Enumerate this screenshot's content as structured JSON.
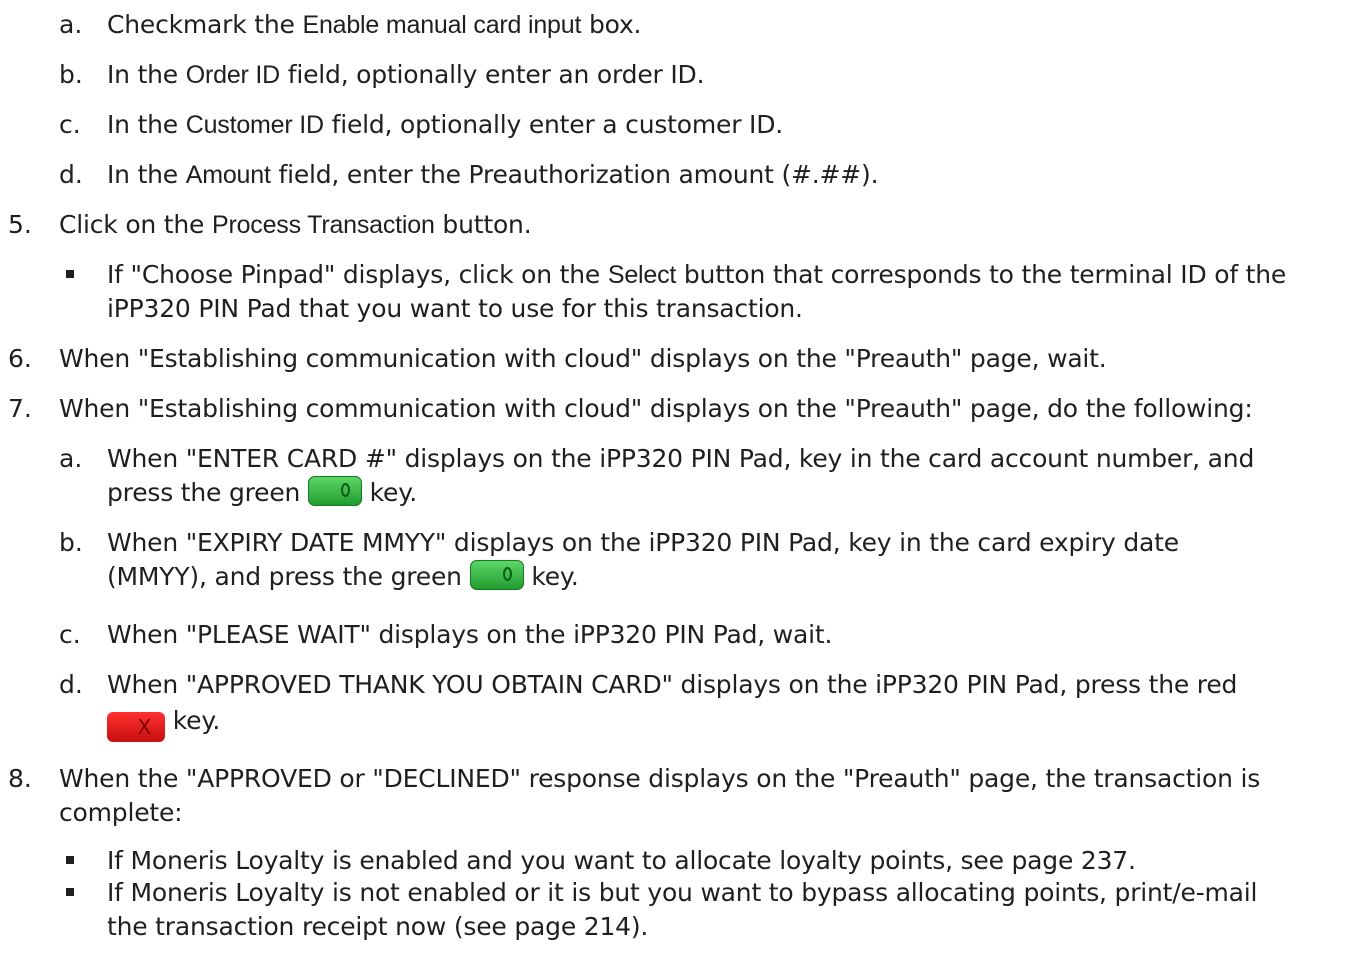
{
  "steps": {
    "s4a": {
      "marker": "a.",
      "pre": "Checkmark the ",
      "ui": "Enable manual card input",
      "post": " box."
    },
    "s4b": {
      "marker": "b.",
      "pre": "In the ",
      "ui": "Order ID",
      "post": " field, optionally enter an order ID."
    },
    "s4c": {
      "marker": "c.",
      "pre": "In the ",
      "ui": "Customer ID",
      "post": " field, optionally enter a customer ID."
    },
    "s4d": {
      "marker": "d.",
      "pre": "In the ",
      "ui": "Amount",
      "post": " field, enter the Preauthorization amount (#.##)."
    },
    "s5": {
      "marker": "5.",
      "pre": "Click on the ",
      "ui": "Process Transaction",
      "post": " button."
    },
    "s5b": {
      "line1_pre": "If \"Choose Pinpad\" displays, click on the ",
      "line1_ui": "Select",
      "line1_post": " button that corresponds to the terminal ID of the",
      "line2": "iPP320 PIN Pad that you want to use for this transaction."
    },
    "s6": {
      "marker": "6.",
      "text": "When \"Establishing communication with cloud\" displays on the \"Preauth\" page, wait."
    },
    "s7": {
      "marker": "7.",
      "text": "When \"Establishing communication with cloud\" displays on the \"Preauth\" page, do the following:"
    },
    "s7a": {
      "marker": "a.",
      "line1": "When \"ENTER CARD #\" displays on the iPP320 PIN Pad, key in the card account number, and",
      "line2_pre": "press the green ",
      "line2_post": " key."
    },
    "s7b": {
      "marker": "b.",
      "line1": "When \"EXPIRY DATE MMYY\" displays on the iPP320 PIN Pad, key in the card expiry date",
      "line2_pre": "(MMYY), and press the green ",
      "line2_post": " key."
    },
    "s7c": {
      "marker": "c.",
      "text": "When \"PLEASE WAIT\" displays on the iPP320 PIN Pad, wait."
    },
    "s7d": {
      "marker": "d.",
      "line1": "When \"APPROVED THANK YOU OBTAIN CARD\" displays on the iPP320 PIN Pad, press the red",
      "line2_post": " key."
    },
    "s8": {
      "marker": "8.",
      "line1": "When the \"APPROVED or \"DECLINED\" response displays on the \"Preauth\" page, the transaction is",
      "line2": "complete:"
    },
    "s8b1": {
      "text": "If Moneris Loyalty is enabled and you want to allocate loyalty points, see page 237."
    },
    "s8b2": {
      "line1": "If Moneris Loyalty is not enabled or it is but you want to bypass allocating points, print/e-mail",
      "line2": "the transaction receipt now (see page 214)."
    }
  },
  "icons": {
    "green_key": "green-ok-key-icon",
    "red_key": "red-cancel-key-icon"
  },
  "colors": {
    "text": "#1f1f1f",
    "green_key": "#2fb33c",
    "red_key": "#e41c1c"
  }
}
